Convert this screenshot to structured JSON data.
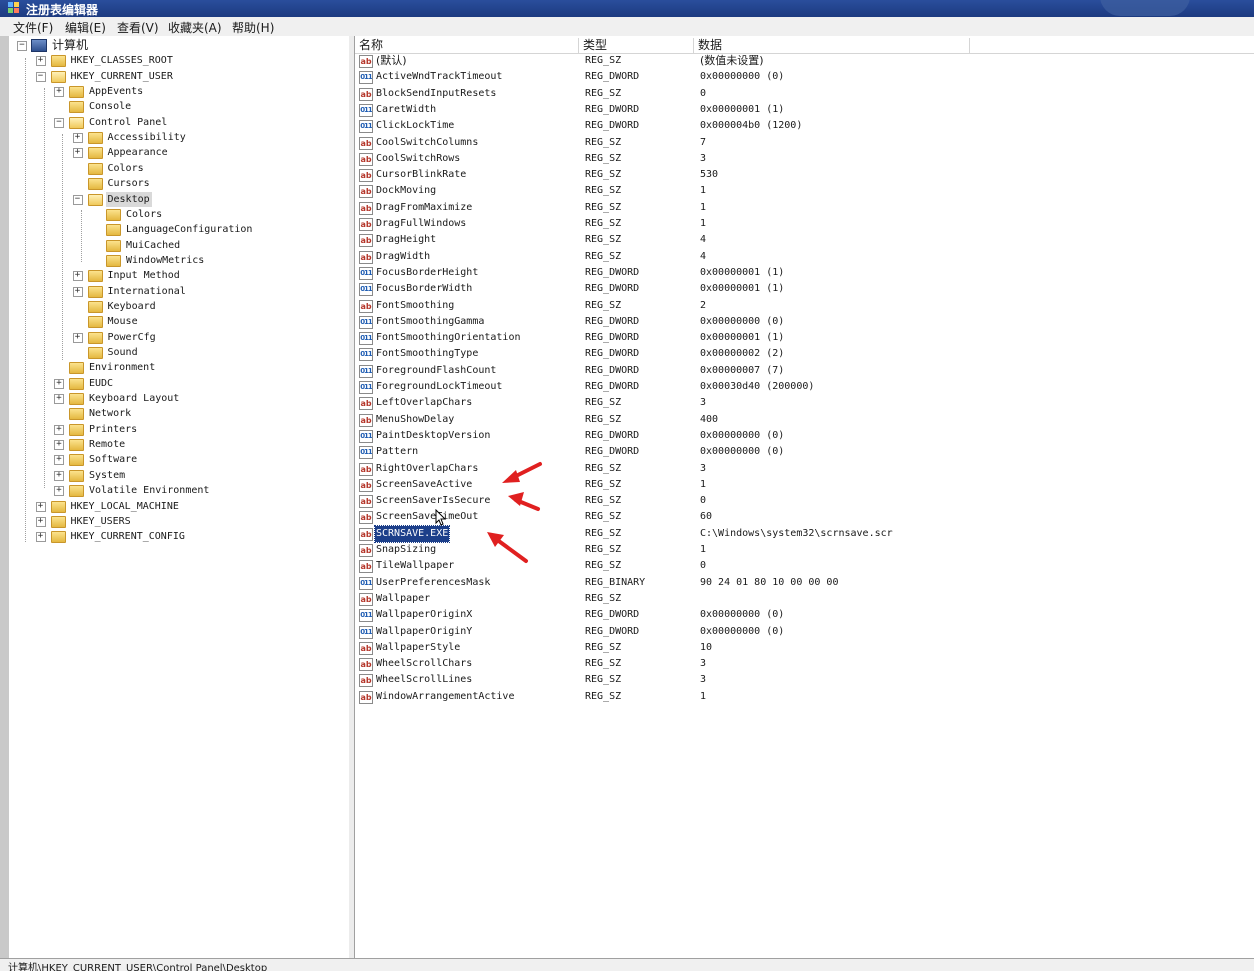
{
  "window": {
    "title": "注册表编辑器",
    "accent": "#1c3a80"
  },
  "menu": [
    "文件(F)",
    "编辑(E)",
    "查看(V)",
    "收藏夹(A)",
    "帮助(H)"
  ],
  "tree": [
    {
      "label": "计算机",
      "expander": "−",
      "icon": "computer-icon",
      "root": true
    },
    {
      "label": "HKEY_CLASSES_ROOT",
      "expander": "+"
    },
    {
      "label": "HKEY_CURRENT_USER",
      "expander": "−",
      "open": true
    },
    {
      "label": "AppEvents",
      "expander": "+"
    },
    {
      "label": "Console",
      "expander": ""
    },
    {
      "label": "Control Panel",
      "expander": "−",
      "open": true
    },
    {
      "label": "Accessibility",
      "expander": "+"
    },
    {
      "label": "Appearance",
      "expander": "+"
    },
    {
      "label": "Colors",
      "expander": ""
    },
    {
      "label": "Cursors",
      "expander": ""
    },
    {
      "label": "Desktop",
      "expander": "−",
      "open": true,
      "selected": true
    },
    {
      "label": "Colors",
      "expander": ""
    },
    {
      "label": "LanguageConfiguration",
      "expander": ""
    },
    {
      "label": "MuiCached",
      "expander": ""
    },
    {
      "label": "WindowMetrics",
      "expander": ""
    },
    {
      "label": "Input Method",
      "expander": "+"
    },
    {
      "label": "International",
      "expander": "+"
    },
    {
      "label": "Keyboard",
      "expander": ""
    },
    {
      "label": "Mouse",
      "expander": ""
    },
    {
      "label": "PowerCfg",
      "expander": "+"
    },
    {
      "label": "Sound",
      "expander": ""
    },
    {
      "label": "Environment",
      "expander": ""
    },
    {
      "label": "EUDC",
      "expander": "+"
    },
    {
      "label": "Keyboard Layout",
      "expander": "+"
    },
    {
      "label": "Network",
      "expander": ""
    },
    {
      "label": "Printers",
      "expander": "+"
    },
    {
      "label": "Remote",
      "expander": "+"
    },
    {
      "label": "Software",
      "expander": "+"
    },
    {
      "label": "System",
      "expander": "+"
    },
    {
      "label": "Volatile Environment",
      "expander": "+"
    },
    {
      "label": "HKEY_LOCAL_MACHINE",
      "expander": "+"
    },
    {
      "label": "HKEY_USERS",
      "expander": "+"
    },
    {
      "label": "HKEY_CURRENT_CONFIG",
      "expander": "+"
    }
  ],
  "columns": {
    "name": "名称",
    "type": "类型",
    "data": "数据"
  },
  "values": [
    {
      "icon": "ab",
      "name": "(默认)",
      "type": "REG_SZ",
      "data": "(数值未设置)"
    },
    {
      "icon": "bin",
      "name": "ActiveWndTrackTimeout",
      "type": "REG_DWORD",
      "data": "0x00000000 (0)"
    },
    {
      "icon": "ab",
      "name": "BlockSendInputResets",
      "type": "REG_SZ",
      "data": "0"
    },
    {
      "icon": "bin",
      "name": "CaretWidth",
      "type": "REG_DWORD",
      "data": "0x00000001 (1)"
    },
    {
      "icon": "bin",
      "name": "ClickLockTime",
      "type": "REG_DWORD",
      "data": "0x000004b0 (1200)"
    },
    {
      "icon": "ab",
      "name": "CoolSwitchColumns",
      "type": "REG_SZ",
      "data": "7"
    },
    {
      "icon": "ab",
      "name": "CoolSwitchRows",
      "type": "REG_SZ",
      "data": "3"
    },
    {
      "icon": "ab",
      "name": "CursorBlinkRate",
      "type": "REG_SZ",
      "data": "530"
    },
    {
      "icon": "ab",
      "name": "DockMoving",
      "type": "REG_SZ",
      "data": "1"
    },
    {
      "icon": "ab",
      "name": "DragFromMaximize",
      "type": "REG_SZ",
      "data": "1"
    },
    {
      "icon": "ab",
      "name": "DragFullWindows",
      "type": "REG_SZ",
      "data": "1"
    },
    {
      "icon": "ab",
      "name": "DragHeight",
      "type": "REG_SZ",
      "data": "4"
    },
    {
      "icon": "ab",
      "name": "DragWidth",
      "type": "REG_SZ",
      "data": "4"
    },
    {
      "icon": "bin",
      "name": "FocusBorderHeight",
      "type": "REG_DWORD",
      "data": "0x00000001 (1)"
    },
    {
      "icon": "bin",
      "name": "FocusBorderWidth",
      "type": "REG_DWORD",
      "data": "0x00000001 (1)"
    },
    {
      "icon": "ab",
      "name": "FontSmoothing",
      "type": "REG_SZ",
      "data": "2"
    },
    {
      "icon": "bin",
      "name": "FontSmoothingGamma",
      "type": "REG_DWORD",
      "data": "0x00000000 (0)"
    },
    {
      "icon": "bin",
      "name": "FontSmoothingOrientation",
      "type": "REG_DWORD",
      "data": "0x00000001 (1)"
    },
    {
      "icon": "bin",
      "name": "FontSmoothingType",
      "type": "REG_DWORD",
      "data": "0x00000002 (2)"
    },
    {
      "icon": "bin",
      "name": "ForegroundFlashCount",
      "type": "REG_DWORD",
      "data": "0x00000007 (7)"
    },
    {
      "icon": "bin",
      "name": "ForegroundLockTimeout",
      "type": "REG_DWORD",
      "data": "0x00030d40 (200000)"
    },
    {
      "icon": "ab",
      "name": "LeftOverlapChars",
      "type": "REG_SZ",
      "data": "3"
    },
    {
      "icon": "ab",
      "name": "MenuShowDelay",
      "type": "REG_SZ",
      "data": "400"
    },
    {
      "icon": "bin",
      "name": "PaintDesktopVersion",
      "type": "REG_DWORD",
      "data": "0x00000000 (0)"
    },
    {
      "icon": "bin",
      "name": "Pattern",
      "type": "REG_DWORD",
      "data": "0x00000000 (0)"
    },
    {
      "icon": "ab",
      "name": "RightOverlapChars",
      "type": "REG_SZ",
      "data": "3"
    },
    {
      "icon": "ab",
      "name": "ScreenSaveActive",
      "type": "REG_SZ",
      "data": "1"
    },
    {
      "icon": "ab",
      "name": "ScreenSaverIsSecure",
      "type": "REG_SZ",
      "data": "0"
    },
    {
      "icon": "ab",
      "name": "ScreenSaveTimeOut",
      "type": "REG_SZ",
      "data": "60"
    },
    {
      "icon": "ab",
      "name": "SCRNSAVE.EXE",
      "type": "REG_SZ",
      "data": "C:\\Windows\\system32\\scrnsave.scr",
      "selected": true
    },
    {
      "icon": "ab",
      "name": "SnapSizing",
      "type": "REG_SZ",
      "data": "1"
    },
    {
      "icon": "ab",
      "name": "TileWallpaper",
      "type": "REG_SZ",
      "data": "0"
    },
    {
      "icon": "bin",
      "name": "UserPreferencesMask",
      "type": "REG_BINARY",
      "data": "90 24 01 80 10 00 00 00"
    },
    {
      "icon": "ab",
      "name": "Wallpaper",
      "type": "REG_SZ",
      "data": ""
    },
    {
      "icon": "bin",
      "name": "WallpaperOriginX",
      "type": "REG_DWORD",
      "data": "0x00000000 (0)"
    },
    {
      "icon": "bin",
      "name": "WallpaperOriginY",
      "type": "REG_DWORD",
      "data": "0x00000000 (0)"
    },
    {
      "icon": "ab",
      "name": "WallpaperStyle",
      "type": "REG_SZ",
      "data": "10"
    },
    {
      "icon": "ab",
      "name": "WheelScrollChars",
      "type": "REG_SZ",
      "data": "3"
    },
    {
      "icon": "ab",
      "name": "WheelScrollLines",
      "type": "REG_SZ",
      "data": "3"
    },
    {
      "icon": "ab",
      "name": "WindowArrangementActive",
      "type": "REG_SZ",
      "data": "1"
    }
  ],
  "icon_text": {
    "ab": "ab",
    "bin": "011"
  },
  "annotation_color": "#e02020",
  "statusbar": "计算机\\HKEY_CURRENT_USER\\Control Panel\\Desktop"
}
